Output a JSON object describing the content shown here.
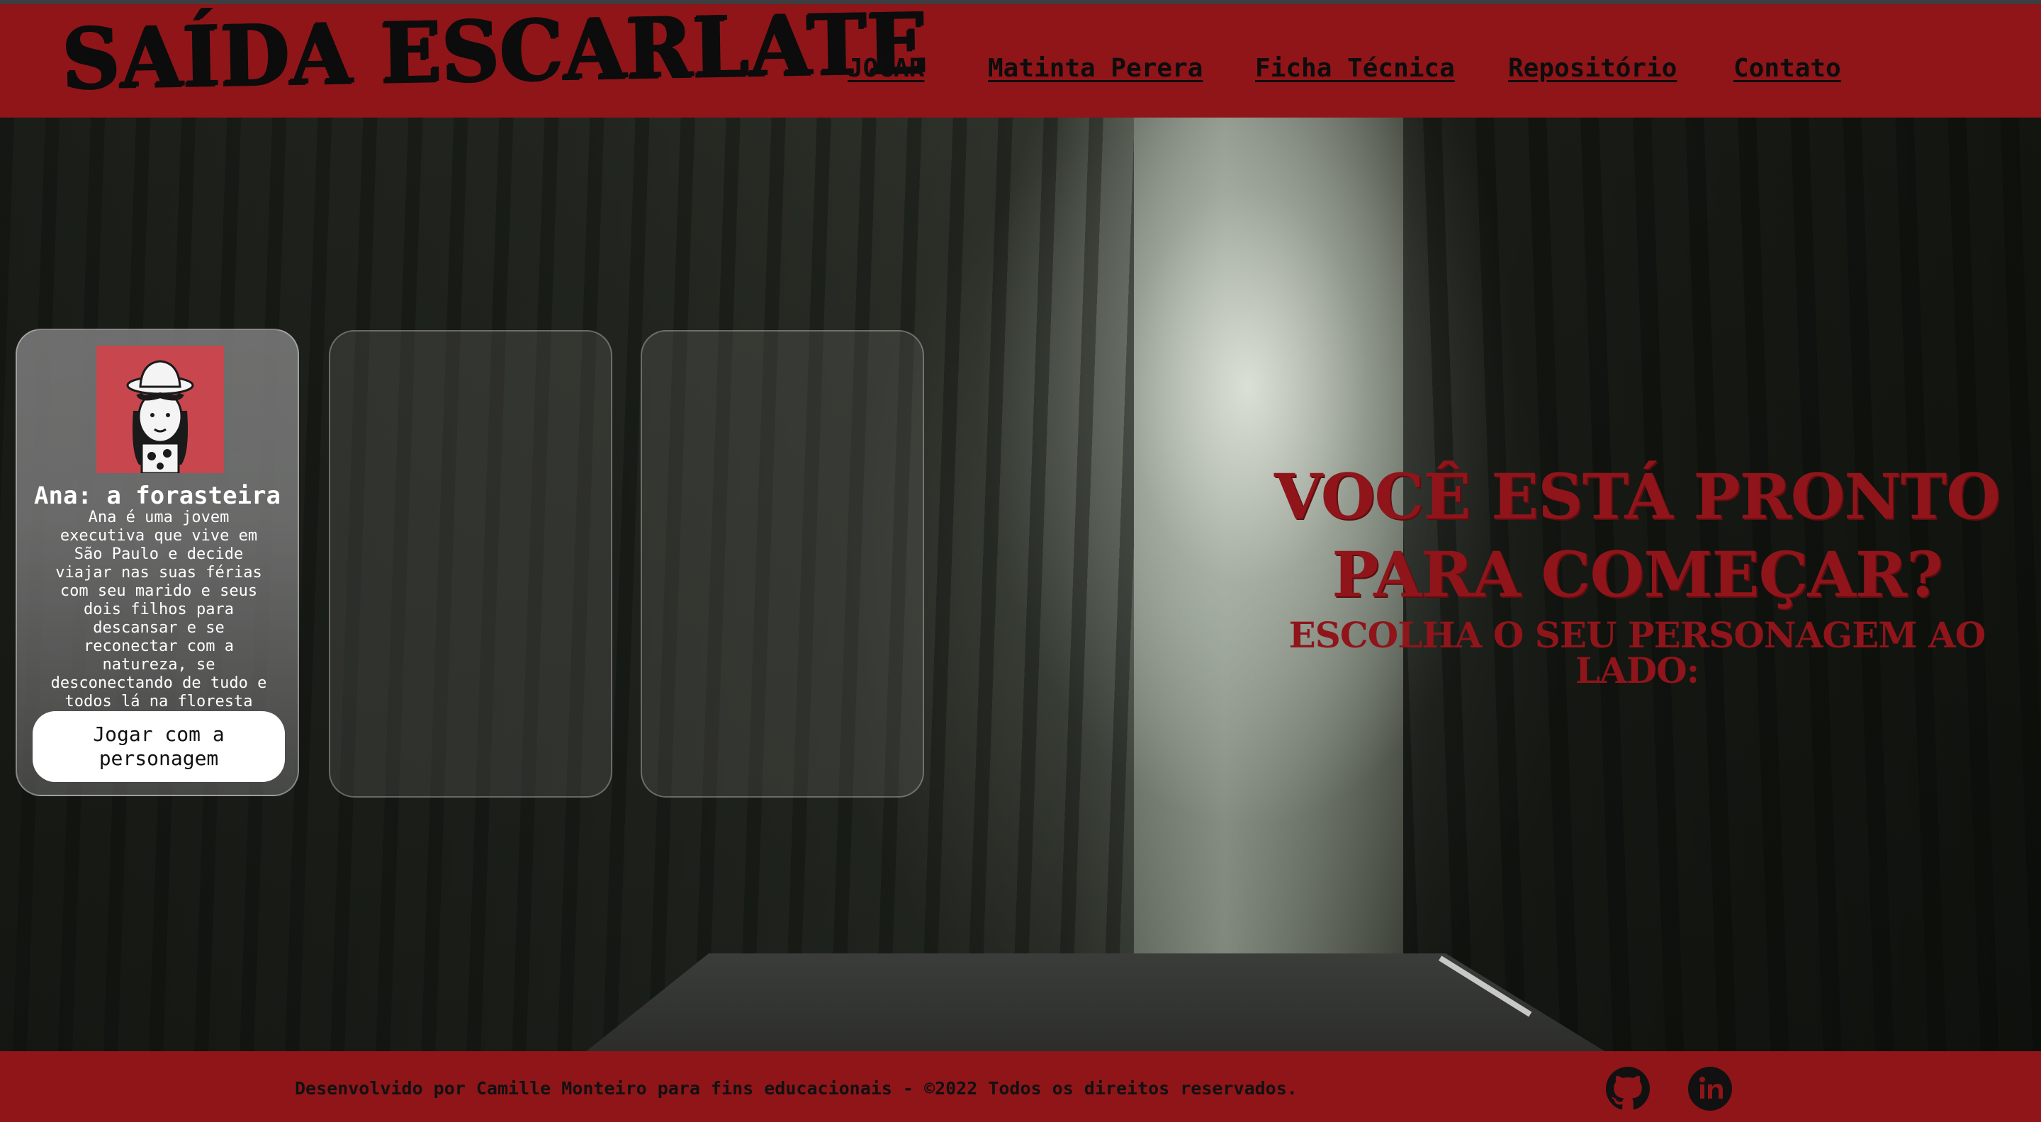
{
  "header": {
    "logo": "SAÍDA ESCARLATE",
    "nav": [
      "JOGAR",
      "Matinta Perera",
      "Ficha Técnica",
      "Repositório",
      "Contato"
    ]
  },
  "cards": [
    {
      "title": "Ana: a forasteira",
      "description": "Ana é uma jovem executiva que vive em São Paulo e decide viajar nas suas férias com seu marido e seus dois filhos para descansar e se reconectar com a natureza, se desconectando de tudo e todos lá na floresta Amazônica.",
      "button": "Jogar com a personagem",
      "avatar_icon": "woman-hat-icon"
    }
  ],
  "hero": {
    "title": "VOCÊ ESTÁ PRONTO PARA COMEÇAR?",
    "subtitle": "ESCOLHA O SEU PERSONAGEM AO LADO:"
  },
  "footer": {
    "credits": "Desenvolvido por Camille Monteiro para fins educacionais - ©2022 Todos os direitos reservados.",
    "social": [
      "github-icon",
      "linkedin-icon"
    ]
  },
  "colors": {
    "brand_red": "#8f1519",
    "card_glass": "#787878"
  }
}
